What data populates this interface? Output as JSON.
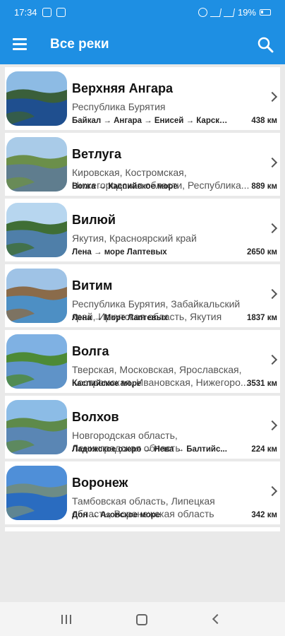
{
  "status": {
    "time": "17:34",
    "battery": "19%"
  },
  "header": {
    "title": "Все реки"
  },
  "rivers": [
    {
      "title": "Верхняя Ангара",
      "region": [
        "Республика Бурятия"
      ],
      "route": "Байкал → Ангара → Енисей → Карско...",
      "length": "438 км",
      "palette": [
        "#8dbbe4",
        "#3a5f3a",
        "#1f4f8f"
      ]
    },
    {
      "title": "Ветлуга",
      "region": [
        "Кировская, Костромская,",
        "Нижегородская области, Республика..."
      ],
      "route": "Волга → Каспийское море",
      "length": "889 км",
      "palette": [
        "#a9cbe8",
        "#6b8f4a",
        "#5f7d8e"
      ]
    },
    {
      "title": "Вилюй",
      "region": [
        "Якутия, Красноярский край"
      ],
      "route": "Лена → море Лаптевых",
      "length": "2650 км",
      "palette": [
        "#b7d6ef",
        "#3f6e35",
        "#4f7fa9"
      ]
    },
    {
      "title": "Витим",
      "region": [
        "Республика Бурятия, Забайкальский",
        "край, Иркутская область, Якутия"
      ],
      "route": "Лена → Море Лаптевых",
      "length": "1837 км",
      "palette": [
        "#9fc3e6",
        "#8a6b4a",
        "#4d8fc4"
      ]
    },
    {
      "title": "Волга",
      "region": [
        "Тверская, Московская, Ярославская,",
        "Костромская, Ивановская, Нижегоро..."
      ],
      "route": "Каспийское море",
      "length": "3531 км",
      "palette": [
        "#7fb1e3",
        "#4d8a36",
        "#5f93c8"
      ]
    },
    {
      "title": "Волхов",
      "region": [
        "Новгородская область,",
        "Ленинградская область"
      ],
      "route": "Ладожское озеро → Нева → Балтийс...",
      "length": "224 км",
      "palette": [
        "#8cbce6",
        "#5e8a4a",
        "#5a86b4"
      ]
    },
    {
      "title": "Воронеж",
      "region": [
        "Тамбовская область, Липецкая",
        "область, Воронежская область"
      ],
      "route": "Дон → Азовское море",
      "length": "342 км",
      "palette": [
        "#4f8fd8",
        "#6d8c86",
        "#2a6cc0"
      ]
    }
  ]
}
